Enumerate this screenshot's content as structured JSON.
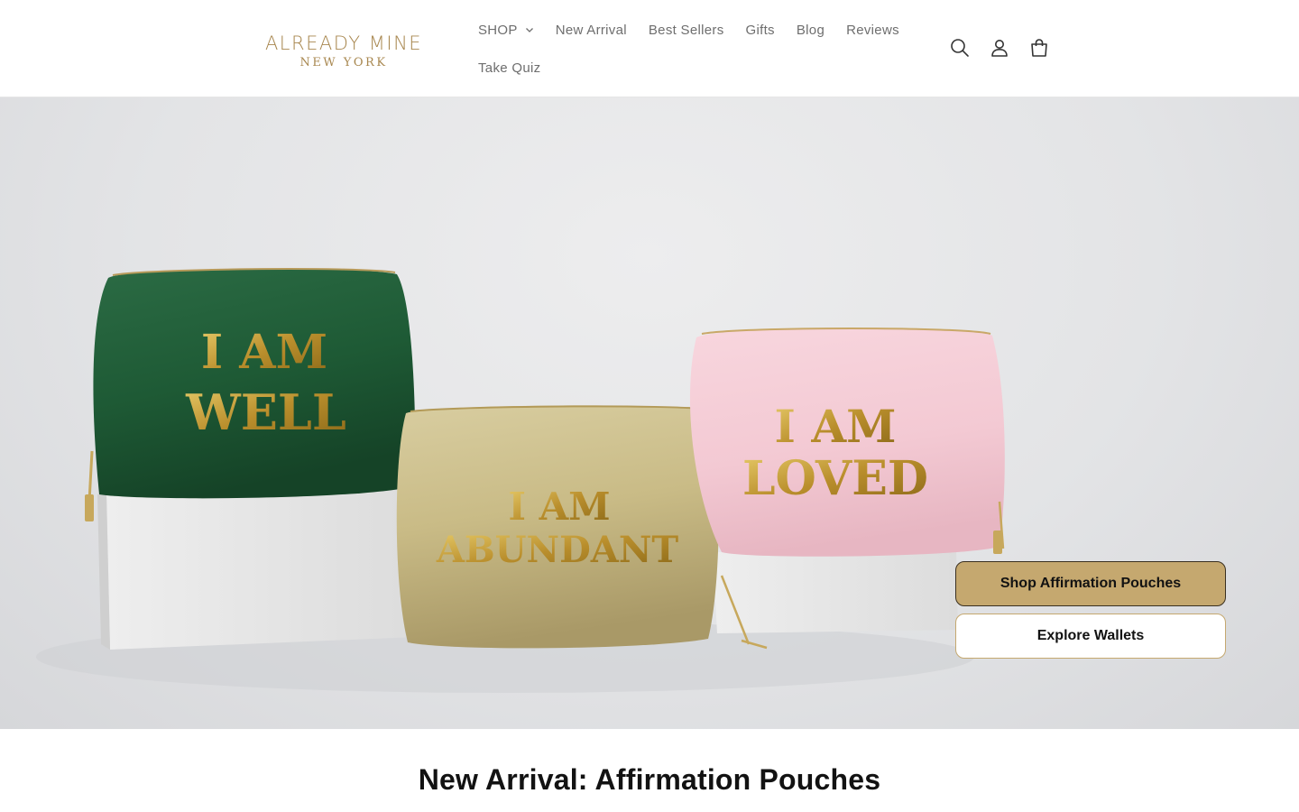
{
  "brand": {
    "name_line1": "ALREADY MINE",
    "name_line2": "NEW YORK",
    "color": "#a8874f"
  },
  "nav": {
    "items": [
      {
        "label": "SHOP",
        "has_dropdown": true
      },
      {
        "label": "New Arrival"
      },
      {
        "label": "Best Sellers"
      },
      {
        "label": "Gifts"
      },
      {
        "label": "Blog"
      },
      {
        "label": "Reviews"
      },
      {
        "label": "Take Quiz"
      }
    ]
  },
  "header_icons": [
    "search-icon",
    "account-icon",
    "cart-icon"
  ],
  "hero": {
    "pouches": [
      {
        "line1": "I AM",
        "line2": "WELL",
        "color": "#1e5a35"
      },
      {
        "line1": "I AM",
        "line2": "ABUNDANT",
        "color": "#c9bb86"
      },
      {
        "line1": "I AM",
        "line2": "LOVED",
        "color": "#f3c9d3"
      }
    ],
    "primary_cta": "Shop Affirmation Pouches",
    "secondary_cta": "Explore Wallets",
    "accent_color": "#c5a86f"
  },
  "section": {
    "title": "New Arrival: Affirmation Pouches"
  }
}
